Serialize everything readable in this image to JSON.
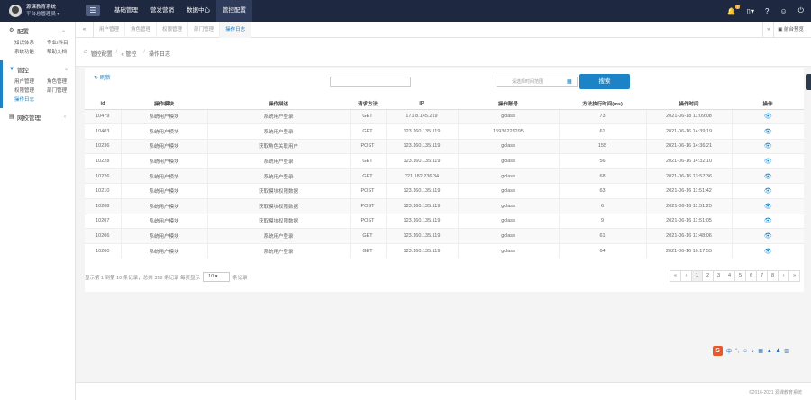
{
  "app": {
    "name": "源课教育系统",
    "role": "平台总管理员 ▾"
  },
  "top_nav": [
    "基础管理",
    "营发营销",
    "数据中心",
    "管控配置"
  ],
  "top_icons": {
    "badge": "7"
  },
  "sidebar": {
    "section1": {
      "title": "配置",
      "items": [
        "知识体系",
        "专业/科目",
        "系统功能",
        "帮助文档"
      ]
    },
    "section2": {
      "title": "管控",
      "items": [
        "用户管理",
        "角色管理",
        "权限管理",
        "部门管理",
        "操作日志"
      ]
    },
    "section3": {
      "title": "网校管理"
    }
  },
  "tabs": [
    "用户管理",
    "角色管理",
    "权限管理",
    "部门管理",
    "操作日志"
  ],
  "tab_right_label": "前台预览",
  "breadcrumb": {
    "home": "管控配置",
    "mid": "管控",
    "current": "操作日志"
  },
  "toolbar": {
    "refresh": "刷新",
    "search": "搜索",
    "date_placeholder": "请选择时间范围"
  },
  "table": {
    "headers": [
      "id",
      "操作模块",
      "操作描述",
      "请求方法",
      "IP",
      "操作账号",
      "方法执行时间(ms)",
      "操作时间",
      "操作"
    ],
    "rows": [
      [
        "10479",
        "系统用户模块",
        "系统用户登录",
        "GET",
        "171.8.145.219",
        "gclass",
        "73",
        "2021-06-18 11:09:08"
      ],
      [
        "10403",
        "系统用户模块",
        "系统用户登录",
        "GET",
        "123.160.135.119",
        "15936229295",
        "61",
        "2021-06-16 14:39:19"
      ],
      [
        "10236",
        "系统用户模块",
        "获取角色关联用户",
        "POST",
        "123.160.135.119",
        "gclass",
        "155",
        "2021-06-16 14:36:21"
      ],
      [
        "10228",
        "系统用户模块",
        "系统用户登录",
        "GET",
        "123.160.135.119",
        "gclass",
        "56",
        "2021-06-16 14:32:10"
      ],
      [
        "10226",
        "系统用户模块",
        "系统用户登录",
        "GET",
        "221.182.236.34",
        "gclass",
        "68",
        "2021-06-16 13:57:36"
      ],
      [
        "10210",
        "系统用户模块",
        "获取模块权限数据",
        "POST",
        "123.160.135.119",
        "gclass",
        "63",
        "2021-06-16 11:51:42"
      ],
      [
        "10208",
        "系统用户模块",
        "获取模块权限数据",
        "POST",
        "123.160.135.119",
        "gclass",
        "6",
        "2021-06-16 11:51:25"
      ],
      [
        "10207",
        "系统用户模块",
        "获取模块权限数据",
        "POST",
        "123.160.135.119",
        "gclass",
        "9",
        "2021-06-16 11:51:05"
      ],
      [
        "10206",
        "系统用户模块",
        "系统用户登录",
        "GET",
        "123.160.135.119",
        "gclass",
        "61",
        "2021-06-16 11:48:06"
      ],
      [
        "10200",
        "系统用户模块",
        "系统用户登录",
        "GET",
        "123.160.135.119",
        "gclass",
        "64",
        "2021-06-16 10:17:55"
      ]
    ]
  },
  "pagination": {
    "info_prefix": "显示第 1 到第 10 条记录，总共 318 条记录 每页显示",
    "page_size": "10",
    "info_suffix": "条记录",
    "pages": [
      "«",
      "‹",
      "1",
      "2",
      "3",
      "4",
      "5",
      "6",
      "7",
      "8",
      "›",
      "»"
    ],
    "current": "1"
  },
  "footer": {
    "copyright": "©2016-2021 源课教育系统"
  },
  "colors": {
    "accent": "#1c84c6",
    "topbar": "#1e2840"
  }
}
